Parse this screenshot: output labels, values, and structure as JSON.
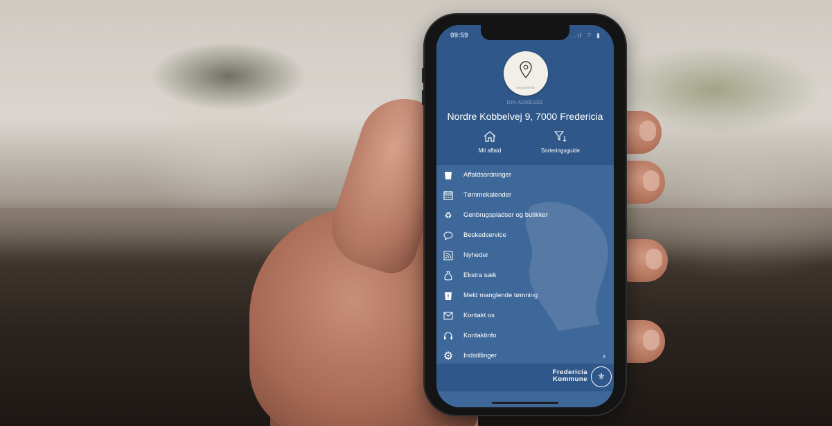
{
  "status_bar": {
    "time": "09:59",
    "icons": "..ıl ⌔ ▮"
  },
  "header": {
    "address_caption": "DIN ADRESSE",
    "address": "Nordre Kobbelvej 9, 7000 Fredericia",
    "circle_caption": "DIN ADRESSE"
  },
  "quick_actions": [
    {
      "label": "Mit affald",
      "icon": "house-icon"
    },
    {
      "label": "Sorteringsguide",
      "icon": "sort-filter-icon"
    }
  ],
  "menu": {
    "items": [
      {
        "label": "Affaldsordninger",
        "icon": "waste-bin-icon"
      },
      {
        "label": "Tømmekalender",
        "icon": "calendar-icon"
      },
      {
        "label": "Genbrugspladser og butikker",
        "icon": "recycle-icon"
      },
      {
        "label": "Beskedservice",
        "icon": "chat-bubble-icon"
      },
      {
        "label": "Nyheder",
        "icon": "rss-icon"
      },
      {
        "label": "Ekstra sæk",
        "icon": "sack-icon"
      },
      {
        "label": "Meld manglende tømning",
        "icon": "bin-alert-icon"
      },
      {
        "label": "Kontakt os",
        "icon": "mail-icon"
      },
      {
        "label": "Kontaktinfo",
        "icon": "headset-icon"
      },
      {
        "label": "Indstillinger",
        "icon": "gear-icon"
      }
    ]
  },
  "footer": {
    "logo_line1": "Fredericia",
    "logo_line2": "Kommune"
  },
  "colors": {
    "header": "#2f5789",
    "menu": "#3e6899",
    "text": "#ffffff"
  }
}
